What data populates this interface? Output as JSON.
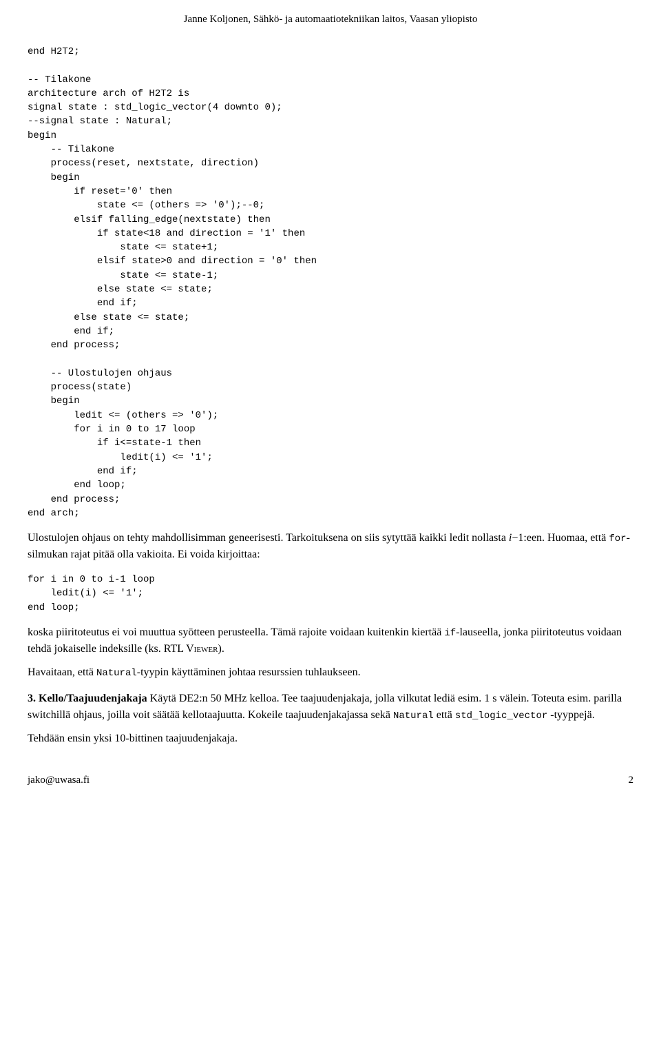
{
  "header": {
    "text": "Janne Koljonen, Sähkö- ja automaatiotekniikan laitos, Vaasan yliopisto"
  },
  "main_code": "end H2T2;\n\n-- Tilakone\narchitecture arch of H2T2 is\nsignal state : std_logic_vector(4 downto 0);\n--signal state : Natural;\nbegin\n    -- Tilakone\n    process(reset, nextstate, direction)\n    begin\n        if reset='0' then\n            state <= (others => '0');--0;\n        elsif falling_edge(nextstate) then\n            if state<18 and direction = '1' then\n                state <= state+1;\n            elsif state>0 and direction = '0' then\n                state <= state-1;\n            else state <= state;\n            end if;\n        else state <= state;\n        end if;\n    end process;\n\n    -- Ulostulojen ohjaus\n    process(state)\n    begin\n        ledit <= (others => '0');\n        for i in 0 to 17 loop\n            if i<=state-1 then\n                ledit(i) <= '1';\n            end if;\n        end loop;\n    end process;\nend arch;",
  "para1": "Ulostulojen ohjaus on tehty mahdollisimman geneerisesti. Tarkoituksena on siis sytyttää kaikki ledit nollasta ",
  "para1_italic": "i",
  "para1_rest": "−1:een. Huomaa, että ",
  "para1_code1": "for",
  "para1_rest2": "-silmukan rajat pitää olla vakioita. Ei voida kirjoittaa:",
  "small_code": "for i in 0 to i-1 loop\n    ledit(i) <= '1';\nend loop;",
  "para2": "koska piiritoteutus ei voi muuttua syötteen perusteella. Tämä rajoite voidaan kuitenkin kiertää ",
  "para2_code": "if",
  "para2_rest": "-lauseella, jonka piiritoteutus voidaan tehdä jokaiselle indeksille (ks. ",
  "para2_rtl": "RTL Viewer",
  "para2_end": ").",
  "para3": "Havaitaan, että ",
  "para3_code": "Natural",
  "para3_rest": "-tyypin käyttäminen johtaa resurssien tuhlaukseen.",
  "section3_label": "3.",
  "section3_title": "Kello/Taajuudenjakaja",
  "section3_text": " Käytä DE2:n 50 MHz kelloa. Tee taajuudenjakaja, jolla vilkutat lediä esim. 1 s välein. Toteuta esim. parilla switchillä ohjaus, joilla voit säätää kellotaajuutta. Kokeile taajuudenjakajassa sekä ",
  "section3_code1": "Natural",
  "section3_mid": " että ",
  "section3_code2": "std_logic_vector",
  "section3_end": " -tyyppejä.",
  "para4": "Tehdään ensin yksi 10-bittinen taajuudenjakaja.",
  "footer": {
    "email": "jako@uwasa.fi",
    "page": "2"
  }
}
